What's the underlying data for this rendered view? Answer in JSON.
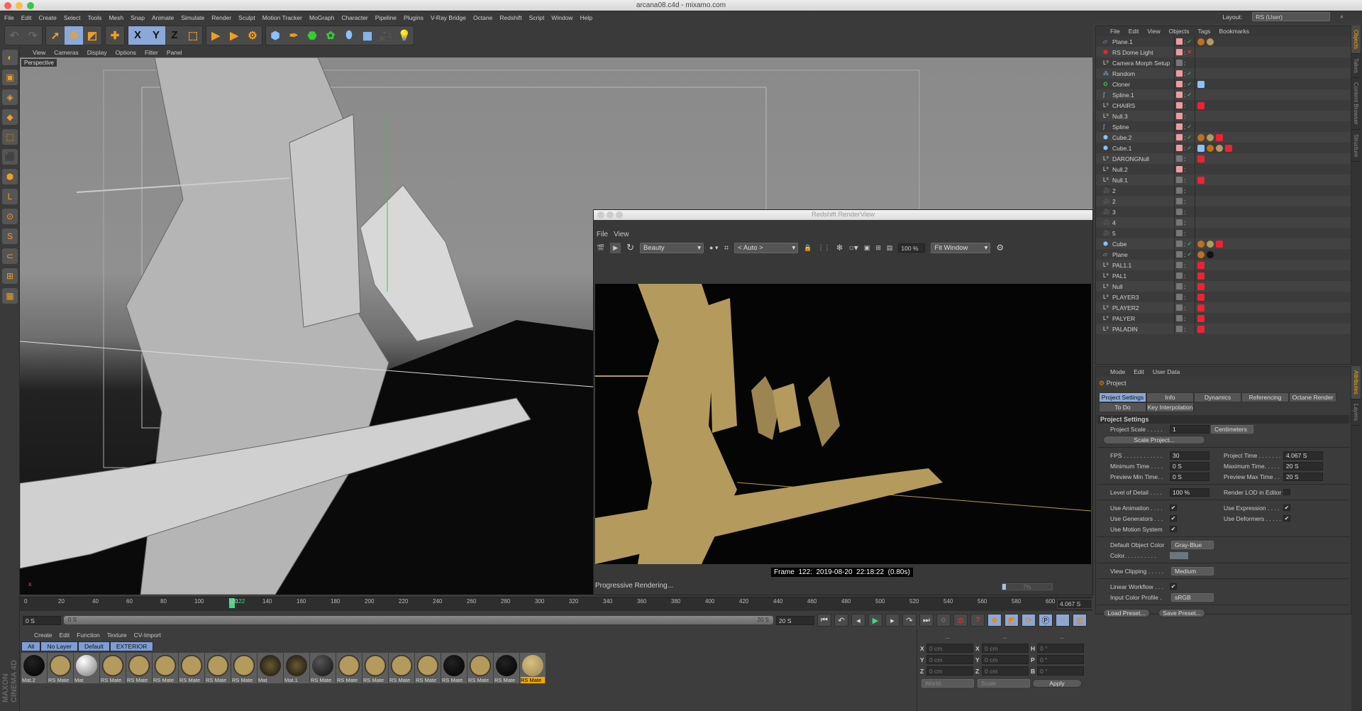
{
  "window": {
    "title": "arcana08.c4d - mixamo.com"
  },
  "menu": [
    "File",
    "Edit",
    "Create",
    "Select",
    "Tools",
    "Mesh",
    "Snap",
    "Animate",
    "Simulate",
    "Render",
    "Sculpt",
    "Motion Tracker",
    "MoGraph",
    "Character",
    "Pipeline",
    "Plugins",
    "V-Ray Bridge",
    "Octane",
    "Redshift",
    "Script",
    "Window",
    "Help"
  ],
  "layout": {
    "label": "Layout:",
    "value": "RS (User)"
  },
  "toolbar": {
    "icons": [
      "undo-icon",
      "redo-icon",
      "select-icon",
      "move-icon",
      "scale-icon",
      "rotate-icon",
      "add-icon",
      "x-axis-icon",
      "y-axis-icon",
      "z-axis-icon",
      "coordinate-system-icon",
      "render-view-icon",
      "render-picture-viewer-icon",
      "render-settings-icon",
      "cube-icon",
      "pen-icon",
      "subdivision-icon",
      "cloner-icon",
      "deformer-icon",
      "floor-icon",
      "camera-icon",
      "light-icon"
    ],
    "axis_labels": [
      "X",
      "Y",
      "Z"
    ]
  },
  "viewport": {
    "menu": [
      "View",
      "Cameras",
      "Display",
      "Options",
      "Filter",
      "Panel"
    ],
    "label": "Perspective"
  },
  "renderview": {
    "title": "Redshift RenderView",
    "menu": [
      "File",
      "View"
    ],
    "aov": "Beauty",
    "camera": "< Auto >",
    "zoom": "100 %",
    "fit": "Fit Window",
    "frame_info": "Frame  122:  2019-08-20  22:18:22  (0.80s)",
    "status": "Progressive Rendering...",
    "progress_label": "7%",
    "progress": 7
  },
  "timeline": {
    "ticks": [
      0,
      20,
      40,
      60,
      80,
      100,
      120,
      140,
      160,
      180,
      200,
      220,
      240,
      260,
      280,
      300,
      320,
      340,
      360,
      380,
      400,
      420,
      440,
      460,
      480,
      500,
      520,
      540,
      560,
      580,
      600
    ],
    "current_frame": "122",
    "project_time": "4.067 S",
    "start": "0 S",
    "slider_start": "0 S",
    "slider_end": "20 S",
    "end": "20 S",
    "accent": "#3ddc84"
  },
  "materials": {
    "menu": [
      "Create",
      "Edit",
      "Function",
      "Texture",
      "CV-Import"
    ],
    "tabs": [
      "All",
      "No Layer",
      "Default",
      "EXTERIOR"
    ],
    "items": [
      {
        "name": "Mat.2",
        "kind": "black"
      },
      {
        "name": "RS Mate",
        "kind": "gold"
      },
      {
        "name": "Mat",
        "kind": "white"
      },
      {
        "name": "RS Mate",
        "kind": "gold"
      },
      {
        "name": "RS Mate",
        "kind": "gold"
      },
      {
        "name": "RS Mate",
        "kind": "gold"
      },
      {
        "name": "RS Mate",
        "kind": "gold"
      },
      {
        "name": "RS Mate",
        "kind": "gold"
      },
      {
        "name": "RS Mate",
        "kind": "gold"
      },
      {
        "name": "Mat",
        "kind": "pattern"
      },
      {
        "name": "Mat.1",
        "kind": "pattern"
      },
      {
        "name": "RS Mate",
        "kind": "dark"
      },
      {
        "name": "RS Mate",
        "kind": "gold"
      },
      {
        "name": "RS Mate",
        "kind": "gold"
      },
      {
        "name": "RS Mate",
        "kind": "gold"
      },
      {
        "name": "RS Mate",
        "kind": "gold"
      },
      {
        "name": "RS Mate",
        "kind": "black"
      },
      {
        "name": "RS Mate",
        "kind": "gold"
      },
      {
        "name": "RS Mate",
        "kind": "black"
      },
      {
        "name": "RS Mate",
        "kind": "textured",
        "selected": true
      }
    ]
  },
  "coords": {
    "header": [
      "--",
      "--",
      "--"
    ],
    "rows": [
      [
        "X",
        "0 cm",
        "X",
        "0 cm",
        "H",
        "0 °"
      ],
      [
        "Y",
        "0 cm",
        "Y",
        "0 cm",
        "P",
        "0 °"
      ],
      [
        "Z",
        "0 cm",
        "Z",
        "0 cm",
        "B",
        "0 °"
      ]
    ],
    "mode": "World",
    "size_mode": "Scale",
    "apply": "Apply"
  },
  "objects": {
    "menu": [
      "File",
      "Edit",
      "View",
      "Objects",
      "Tags",
      "Bookmarks"
    ],
    "items": [
      {
        "name": "Plane.1",
        "icon": "plane",
        "pink": true,
        "check": "ok",
        "tags": [
          "phong",
          "mat-gold"
        ]
      },
      {
        "name": "RS Dome Light",
        "icon": "light",
        "pink": true,
        "check": "off",
        "tags": []
      },
      {
        "name": "Camera Morph Setup",
        "icon": "null",
        "pink": false,
        "check": "",
        "tags": []
      },
      {
        "name": "Random",
        "icon": "effector",
        "pink": true,
        "check": "ok",
        "tags": []
      },
      {
        "name": "Cloner",
        "icon": "cloner",
        "pink": true,
        "check": "ok",
        "tags": [
          "spline"
        ]
      },
      {
        "name": "Spline.1",
        "icon": "spline",
        "pink": true,
        "check": "ok",
        "tags": []
      },
      {
        "name": "CHAIRS",
        "icon": "null",
        "pink": true,
        "check": "",
        "tags": [
          "rs"
        ]
      },
      {
        "name": "Null.3",
        "icon": "null",
        "pink": true,
        "check": "",
        "tags": []
      },
      {
        "name": "Spline",
        "icon": "spline",
        "pink": true,
        "check": "ok",
        "tags": []
      },
      {
        "name": "Cube.2",
        "icon": "cube",
        "pink": true,
        "check": "ok",
        "tags": [
          "phong",
          "mat-gold",
          "rs"
        ]
      },
      {
        "name": "Cube.1",
        "icon": "cube",
        "pink": true,
        "check": "ok",
        "tags": [
          "spline",
          "phong",
          "mat-gold",
          "rs"
        ]
      },
      {
        "name": "DARONGNull",
        "icon": "null",
        "pink": false,
        "check": "",
        "tags": [
          "rs"
        ]
      },
      {
        "name": "Null.2",
        "icon": "null",
        "pink": true,
        "check": "",
        "tags": []
      },
      {
        "name": "Null.1",
        "icon": "null",
        "pink": false,
        "check": "",
        "tags": [
          "rs"
        ]
      },
      {
        "name": "2",
        "icon": "camera",
        "pink": false,
        "check": "",
        "tags": []
      },
      {
        "name": "2",
        "icon": "camera",
        "pink": false,
        "check": "",
        "tags": []
      },
      {
        "name": "3",
        "icon": "camera",
        "pink": false,
        "check": "",
        "tags": []
      },
      {
        "name": "4",
        "icon": "camera",
        "pink": false,
        "check": "",
        "tags": []
      },
      {
        "name": "5",
        "icon": "camera",
        "pink": false,
        "check": "",
        "tags": []
      },
      {
        "name": "Cube",
        "icon": "cube",
        "pink": false,
        "check": "ok",
        "tags": [
          "phong",
          "mat-gold",
          "rs"
        ]
      },
      {
        "name": "Plane",
        "icon": "plane",
        "pink": false,
        "check": "ok",
        "tags": [
          "phong",
          "mat-black"
        ]
      },
      {
        "name": "PAL1.1",
        "icon": "null",
        "pink": false,
        "check": "",
        "tags": [
          "rs"
        ]
      },
      {
        "name": "PAL1",
        "icon": "null",
        "pink": false,
        "check": "",
        "tags": [
          "rs"
        ]
      },
      {
        "name": "Null",
        "icon": "null",
        "pink": false,
        "check": "",
        "tags": [
          "rs"
        ]
      },
      {
        "name": "PLAYER3",
        "icon": "null",
        "pink": false,
        "check": "",
        "tags": [
          "rs"
        ]
      },
      {
        "name": "PLAYER2",
        "icon": "null",
        "pink": false,
        "check": "",
        "tags": [
          "rs"
        ]
      },
      {
        "name": "PALYER",
        "icon": "null",
        "pink": false,
        "check": "",
        "tags": [
          "rs"
        ]
      },
      {
        "name": "PALADIN",
        "icon": "null",
        "pink": false,
        "check": "",
        "tags": [
          "rs"
        ]
      }
    ]
  },
  "side_tabs_top": [
    "Objects",
    "Takes",
    "Content Browser",
    "Structure"
  ],
  "side_tabs_bottom": [
    "Attributes",
    "Layers"
  ],
  "attributes": {
    "menu": [
      "Mode",
      "Edit",
      "User Data"
    ],
    "object": "Project",
    "tabs": [
      "Project Settings",
      "Info",
      "Dynamics",
      "Referencing",
      "Octane Render",
      "To Do",
      "Key Interpolation"
    ],
    "section": "Project Settings",
    "project_scale": {
      "label": "Project Scale . . . . .",
      "value": "1",
      "unit": "Centimeters"
    },
    "scale_button": "Scale Project...",
    "fps": {
      "label": "FPS . . . . . . . . . . . .",
      "value": "30"
    },
    "project_time": {
      "label": "Project Time . . . . . . .",
      "value": "4.067 S"
    },
    "min_time": {
      "label": "Minimum Time . . . .",
      "value": "0 S"
    },
    "max_time": {
      "label": "Maximum Time. . . . .",
      "value": "20 S"
    },
    "prev_min": {
      "label": "Preview Min Time. .",
      "value": "0 S"
    },
    "prev_max": {
      "label": "Preview Max Time . .",
      "value": "20 S"
    },
    "lod": {
      "label": "Level of Detail . . . .",
      "value": "100 %"
    },
    "render_lod": {
      "label": "Render LOD in Editor",
      "checked": false
    },
    "use_animation": {
      "label": "Use Animation . . . .",
      "checked": true
    },
    "use_expression": {
      "label": "Use Expression . . . .",
      "checked": true
    },
    "use_generators": {
      "label": "Use Generators . . .",
      "checked": true
    },
    "use_deformers": {
      "label": "Use Deformers . . . . .",
      "checked": true
    },
    "use_motion": {
      "label": "Use Motion System",
      "checked": true
    },
    "default_color": {
      "label": "Default Object Color",
      "value": "Gray-Blue"
    },
    "color": {
      "label": "Color. . . . . . . . . .",
      "swatch": "#6a7680"
    },
    "view_clipping": {
      "label": "View Clipping . . . . .",
      "value": "Medium"
    },
    "linear_workflow": {
      "label": "Linear Workflow . . .",
      "checked": true
    },
    "input_profile": {
      "label": "Input Color Profile .",
      "value": "sRGB"
    },
    "load_preset": "Load Preset...",
    "save_preset": "Save Preset..."
  },
  "brand": "MAXON CINEMA 4D",
  "colors": {
    "accent_orange": "#f0a800",
    "selection_blue": "#8aa8d8",
    "gold": "#b49a5c"
  }
}
